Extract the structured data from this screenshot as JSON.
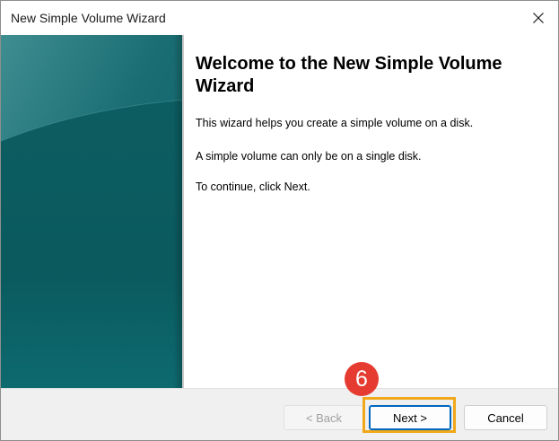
{
  "window": {
    "title": "New Simple Volume Wizard",
    "close_icon": "close-icon"
  },
  "content": {
    "heading": "Welcome to the New Simple Volume Wizard",
    "paragraphs": [
      "This wizard helps you create a simple volume on a disk.",
      "A simple volume can only be on a single disk.",
      "To continue, click Next."
    ]
  },
  "footer": {
    "back_label": "< Back",
    "back_enabled": false,
    "next_label": "Next >",
    "cancel_label": "Cancel"
  },
  "annotation": {
    "step_number": "6",
    "badge_color": "#e63b30",
    "highlight_color": "#f0a819"
  },
  "colors": {
    "banner_dark": "#0a5659",
    "banner_light": "#2f8287",
    "accent_button_border": "#0067c0"
  }
}
